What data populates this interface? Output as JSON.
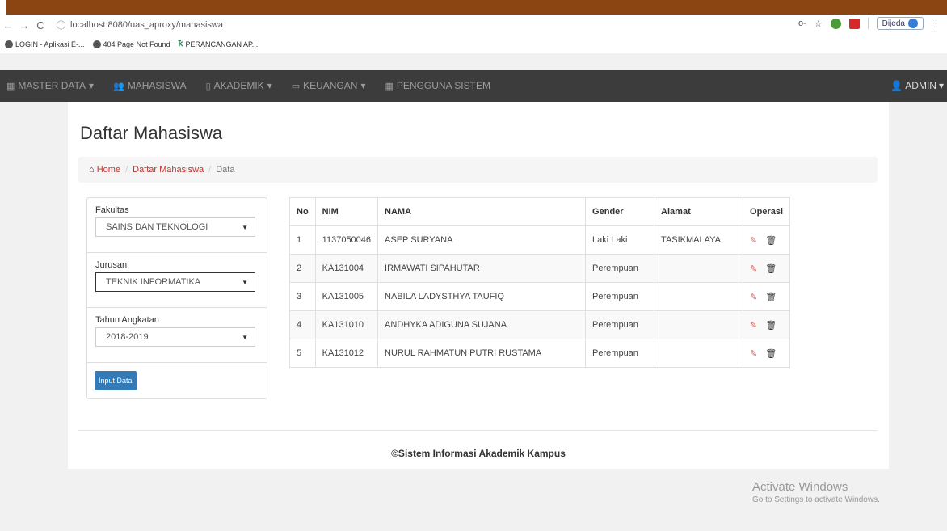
{
  "browser": {
    "url": "localhost:8080/uas_aproxy/mahasiswa",
    "profile_label": "Dijeda",
    "bookmarks": [
      {
        "label": "LOGIN - Aplikasi E-..."
      },
      {
        "label": "404 Page Not Found"
      },
      {
        "label": "PERANCANGAN AP..."
      }
    ]
  },
  "navbar": {
    "items": [
      {
        "label": "MASTER DATA",
        "icon": "table-icon",
        "dropdown": true
      },
      {
        "label": "MAHASISWA",
        "icon": "users-icon",
        "dropdown": false
      },
      {
        "label": "AKADEMIK",
        "icon": "book-icon",
        "dropdown": true
      },
      {
        "label": "KEUANGAN",
        "icon": "card-icon",
        "dropdown": true
      },
      {
        "label": "PENGGUNA SISTEM",
        "icon": "grid-icon",
        "dropdown": false
      }
    ],
    "user_label": "ADMIN"
  },
  "page": {
    "title": "Daftar Mahasiswa",
    "breadcrumb": {
      "home": "Home",
      "section": "Daftar Mahasiswa",
      "current": "Data"
    }
  },
  "filters": {
    "fakultas": {
      "label": "Fakultas",
      "value": "SAINS DAN TEKNOLOGI"
    },
    "jurusan": {
      "label": "Jurusan",
      "value": "TEKNIK INFORMATIKA"
    },
    "tahun": {
      "label": "Tahun Angkatan",
      "value": "2018-2019"
    },
    "input_button": "Input Data"
  },
  "table": {
    "headers": {
      "no": "No",
      "nim": "NIM",
      "nama": "NAMA",
      "gender": "Gender",
      "alamat": "Alamat",
      "operasi": "Operasi"
    },
    "rows": [
      {
        "no": "1",
        "nim": "1137050046",
        "nama": "ASEP SURYANA",
        "gender": "Laki Laki",
        "alamat": "TASIKMALAYA"
      },
      {
        "no": "2",
        "nim": "KA131004",
        "nama": "IRMAWATI SIPAHUTAR",
        "gender": "Perempuan",
        "alamat": ""
      },
      {
        "no": "3",
        "nim": "KA131005",
        "nama": "NABILA LADYSTHYA TAUFIQ",
        "gender": "Perempuan",
        "alamat": ""
      },
      {
        "no": "4",
        "nim": "KA131010",
        "nama": "ANDHYKA ADIGUNA SUJANA",
        "gender": "Perempuan",
        "alamat": ""
      },
      {
        "no": "5",
        "nim": "KA131012",
        "nama": "NURUL RAHMATUN PUTRI RUSTAMA",
        "gender": "Perempuan",
        "alamat": ""
      }
    ]
  },
  "footer": {
    "text": "©Sistem Informasi Akademik Kampus"
  },
  "watermark": {
    "title": "Activate Windows",
    "subtitle": "Go to Settings to activate Windows."
  },
  "colors": {
    "navbar": "#3c3c3c",
    "link": "#c9302c",
    "button": "#337ab7"
  }
}
